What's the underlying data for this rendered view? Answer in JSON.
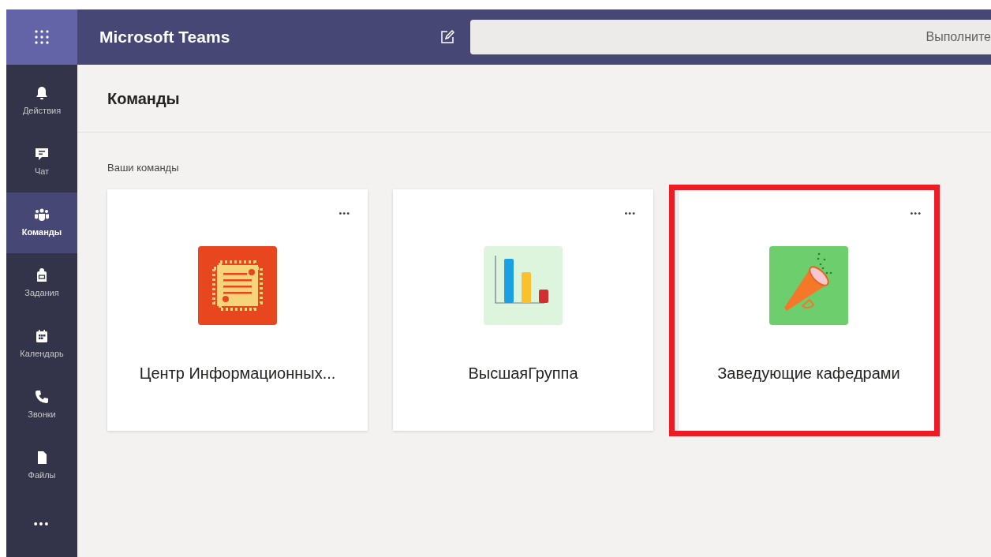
{
  "header": {
    "app_title": "Microsoft Teams",
    "search": {
      "placeholder": "Выполните"
    }
  },
  "rail": {
    "items": [
      {
        "label": "Действия",
        "kind": "bell",
        "selected": false
      },
      {
        "label": "Чат",
        "kind": "chat",
        "selected": false
      },
      {
        "label": "Команды",
        "kind": "teams",
        "selected": true
      },
      {
        "label": "Задания",
        "kind": "bag",
        "selected": false
      },
      {
        "label": "Календарь",
        "kind": "calendar",
        "selected": false
      },
      {
        "label": "Звонки",
        "kind": "phone",
        "selected": false
      },
      {
        "label": "Файлы",
        "kind": "file",
        "selected": false
      }
    ],
    "more": "•••"
  },
  "page": {
    "title": "Команды",
    "section": "Ваши команды",
    "teams": [
      {
        "name": "Центр Информационных...",
        "kind": "chip",
        "highlighted": false,
        "more": "•••"
      },
      {
        "name": "ВысшаяГруппа",
        "kind": "chart",
        "highlighted": false,
        "more": "•••"
      },
      {
        "name": "Заведующие кафедрами",
        "kind": "megaphone",
        "highlighted": true,
        "more": "•••"
      }
    ]
  }
}
